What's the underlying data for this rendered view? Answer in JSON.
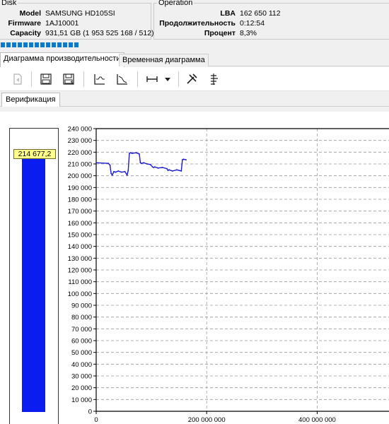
{
  "disk": {
    "group_title": "Disk",
    "model_label": "Model",
    "model_value": "SAMSUNG HD105SI",
    "firmware_label": "Firmware",
    "firmware_value": "1AJ10001",
    "capacity_label": "Capacity",
    "capacity_value": "931,51 GB (1 953 525 168 / 512)"
  },
  "operation": {
    "group_title": "Operation",
    "lba_label": "LBA",
    "lba_value": "162 650 112",
    "duration_label": "Продолжительность",
    "duration_value": "0:12:54",
    "percent_label": "Процент",
    "percent_value": "8,3%"
  },
  "progress": {
    "percent": 8.3
  },
  "tabs": [
    {
      "label": "Диаграмма производительности",
      "active": true
    },
    {
      "label": "Временная диаграмма",
      "active": false
    }
  ],
  "toolbar": {
    "icons": [
      "disk-export-icon",
      "save-icon",
      "save-as-icon",
      "chart-view-icon",
      "chart-decline-icon",
      "range-icon",
      "dropdown-arrow-icon",
      "tools-icon",
      "settings-list-icon"
    ]
  },
  "subtab": {
    "label": "Верификация"
  },
  "meter": {
    "value": 214677.2,
    "label": "214 677,2",
    "max": 240000,
    "color": "#0a1cf0"
  },
  "chart_data": {
    "type": "line",
    "title": "",
    "xlabel": "",
    "ylabel": "",
    "xlim": [
      0,
      530000000
    ],
    "ylim": [
      0,
      240000
    ],
    "y_ticks": [
      "0",
      "10 000",
      "20 000",
      "30 000",
      "40 000",
      "50 000",
      "60 000",
      "70 000",
      "80 000",
      "90 000",
      "100 000",
      "110 000",
      "120 000",
      "130 000",
      "140 000",
      "150 000",
      "160 000",
      "170 000",
      "180 000",
      "190 000",
      "200 000",
      "210 000",
      "220 000",
      "230 000",
      "240 000"
    ],
    "x_ticks": [
      {
        "value": 0,
        "label": "0"
      },
      {
        "value": 200000000,
        "label": "200 000 000"
      },
      {
        "value": 400000000,
        "label": "400 000 000"
      }
    ],
    "grid": true,
    "series": [
      {
        "color": "#1a1ad0",
        "x": [
          0,
          22000000,
          25000000,
          27000000,
          29000000,
          32000000,
          35000000,
          40000000,
          46000000,
          52000000,
          56000000,
          58000000,
          60000000,
          62000000,
          65000000,
          72000000,
          78000000,
          80000000,
          82000000,
          86000000,
          92000000,
          98000000,
          102000000,
          104000000,
          106000000,
          112000000,
          120000000,
          128000000,
          130000000,
          132000000,
          138000000,
          146000000,
          150000000,
          154000000,
          156000000,
          158000000,
          162650112
        ],
        "y": [
          211000,
          210500,
          209000,
          202000,
          200500,
          203500,
          203000,
          204000,
          203000,
          203500,
          200500,
          204500,
          219000,
          219500,
          219000,
          219500,
          218500,
          211000,
          210500,
          211000,
          210000,
          209500,
          207500,
          207000,
          207500,
          206500,
          207000,
          206000,
          204500,
          205000,
          204000,
          205000,
          204500,
          204000,
          213500,
          214000,
          213500
        ]
      }
    ]
  }
}
